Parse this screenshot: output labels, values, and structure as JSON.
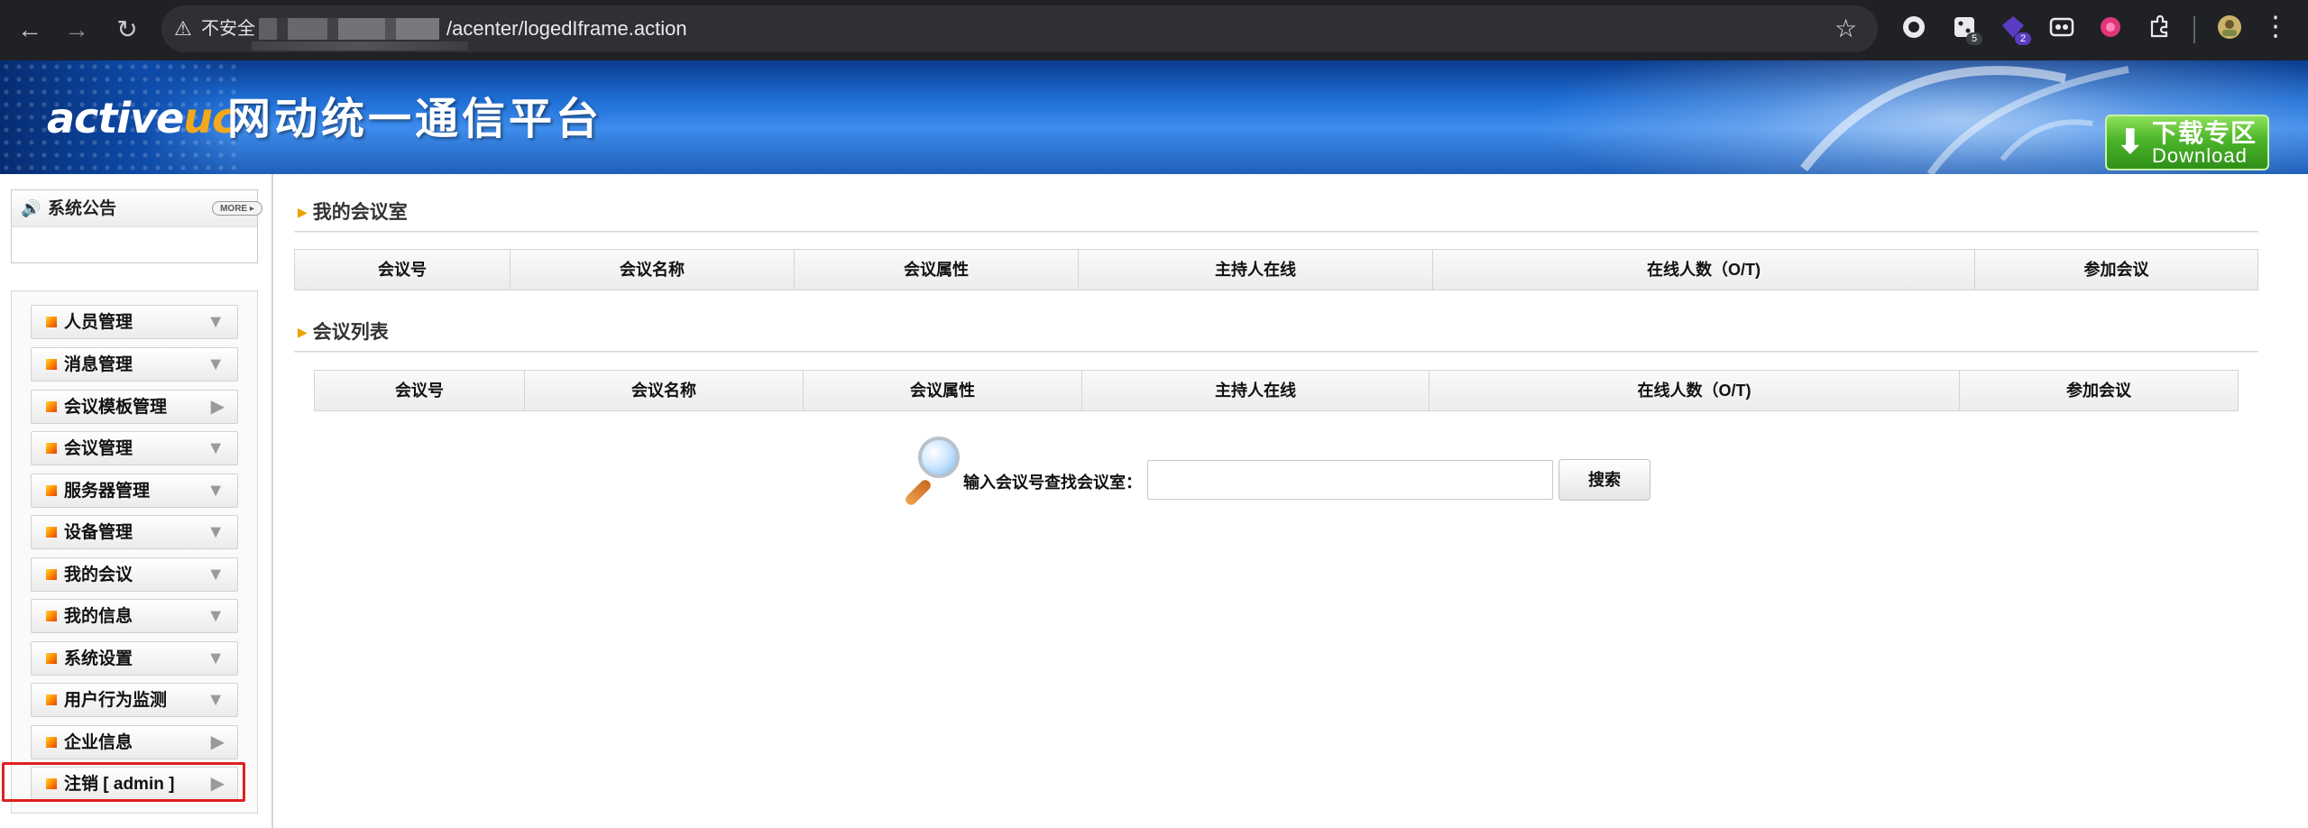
{
  "browser": {
    "security_label": "不安全",
    "url": "/acenter/logedIframe.action",
    "ext_badge_1": "5",
    "ext_badge_2": "2"
  },
  "banner": {
    "logo_a": "a",
    "logo_tive": "ctive",
    "logo_uc": "uc",
    "title": "网动统一通信平台",
    "download_cn": "下载专区",
    "download_en": "Download"
  },
  "notice": {
    "title": "系统公告",
    "more": "MORE"
  },
  "menu": [
    {
      "label": "人员管理",
      "arrow": "▼"
    },
    {
      "label": "消息管理",
      "arrow": "▼"
    },
    {
      "label": "会议模板管理",
      "arrow": "▶"
    },
    {
      "label": "会议管理",
      "arrow": "▼"
    },
    {
      "label": "服务器管理",
      "arrow": "▼"
    },
    {
      "label": "设备管理",
      "arrow": "▼"
    },
    {
      "label": "我的会议",
      "arrow": "▼"
    },
    {
      "label": "我的信息",
      "arrow": "▼"
    },
    {
      "label": "系统设置",
      "arrow": "▼"
    },
    {
      "label": "用户行为监测",
      "arrow": "▼"
    },
    {
      "label": "企业信息",
      "arrow": "▶"
    },
    {
      "label": "注销  [ admin ]",
      "arrow": "▶"
    }
  ],
  "my_rooms": {
    "title": "我的会议室",
    "columns": [
      "会议号",
      "会议名称",
      "会议属性",
      "主持人在线",
      "在线人数（O/T)",
      "参加会议"
    ]
  },
  "meeting_list": {
    "title": "会议列表",
    "columns": [
      "会议号",
      "会议名称",
      "会议属性",
      "主持人在线",
      "在线人数（O/T)",
      "参加会议"
    ]
  },
  "search": {
    "label": "输入会议号查找会议室：",
    "value": "",
    "button": "搜索"
  }
}
